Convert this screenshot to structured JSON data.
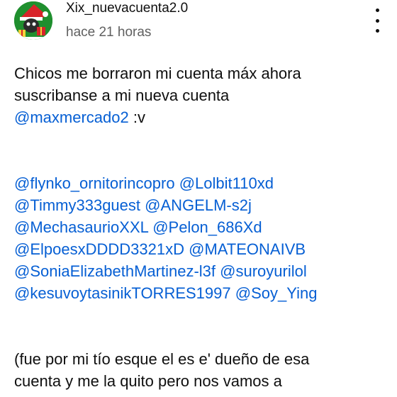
{
  "comment": {
    "username": "Xix_nuevacuenta2.0",
    "timestamp": "hace 21 horas",
    "avatar_icon": "santa-avatar-icon",
    "menu_icon": "more-vert-icon",
    "text_lines": {
      "line1": "Chicos me borraron mi cuenta máx ahora",
      "line2": "suscribanse a mi nueva cuenta",
      "line3_mention": "@maxmercado2",
      "line3_text": " :v"
    },
    "mentions": [
      [
        "@flynko_ornitorincopro",
        "@Lolbit110xd"
      ],
      [
        "@Timmy333guest",
        "@ANGELM-s2j"
      ],
      [
        "@MechasaurioXXL",
        "@Pelon_686Xd"
      ],
      [
        "@ElpoesxDDDD3321xD",
        "@MATEONAIVB"
      ],
      [
        "@SoniaElizabethMartinez-l3f",
        "@suroyurilol"
      ],
      [
        "@kesuvoytasinikTORRES1997",
        "@Soy_Ying"
      ]
    ],
    "footer_lines": {
      "line1": "(fue por mi tío esque el es e' dueño de esa",
      "line2": "cuenta y me la quito pero nos vamos a"
    }
  },
  "colors": {
    "text": "#0f0f0f",
    "secondary": "#606060",
    "mention": "#065fd4",
    "avatar_bg": "#1a8a2a"
  }
}
